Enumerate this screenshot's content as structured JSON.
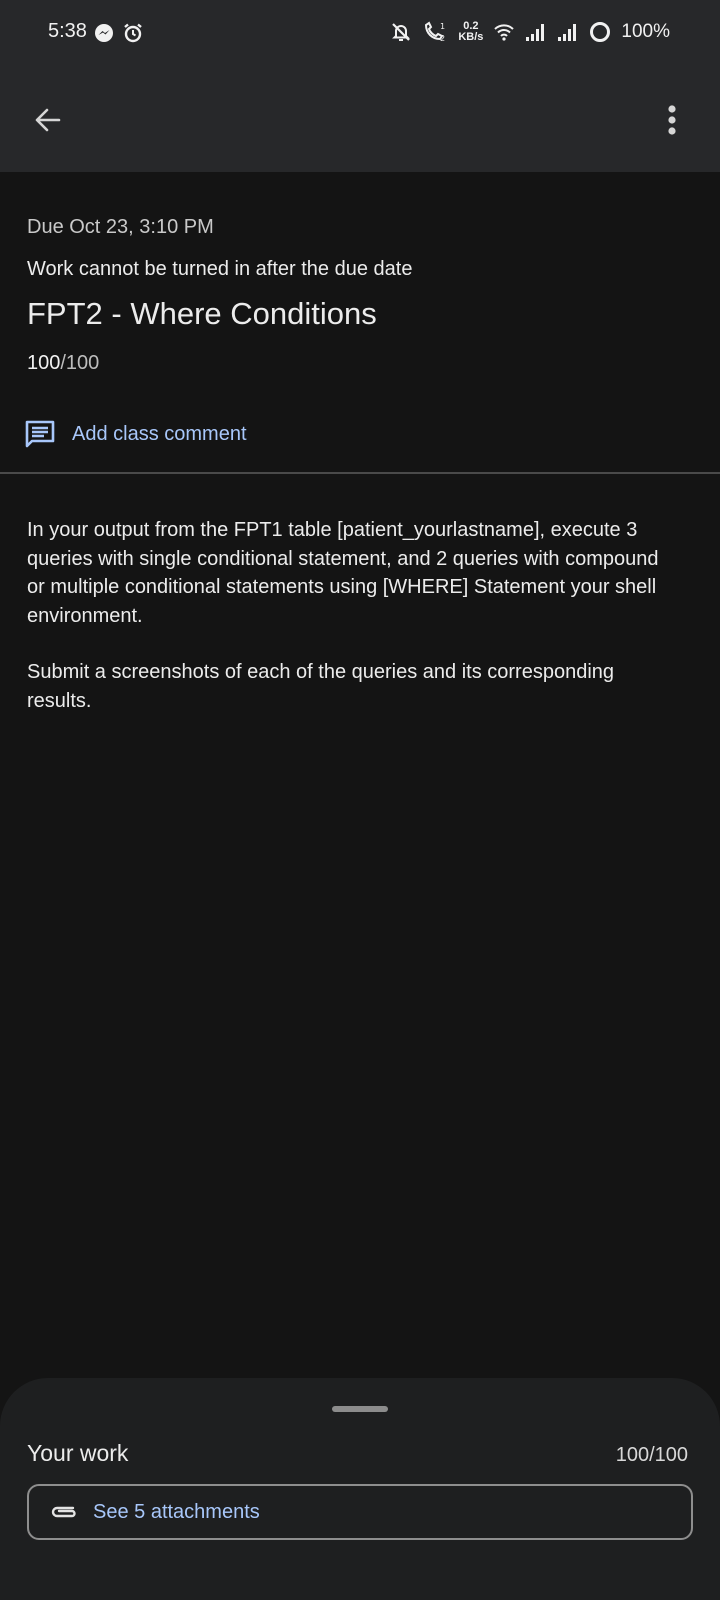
{
  "status_bar": {
    "time": "5:38",
    "data_rate_value": "0.2",
    "data_rate_unit": "KB/s",
    "battery": "100%"
  },
  "header": {
    "back_icon": "arrow-back-icon",
    "more_icon": "more-vert-icon"
  },
  "assignment": {
    "due": "Due Oct 23, 3:10 PM",
    "late_notice": "Work cannot be turned in after the due date",
    "title": "FPT2 - Where Conditions",
    "grade_earned": "100",
    "grade_total": "/100",
    "add_comment_label": "Add class comment",
    "description_p1": "In your output from the FPT1 table [patient_yourlastname], execute 3 queries with single conditional statement, and 2 queries with compound or multiple conditional statements using [WHERE] Statement your shell environment.",
    "description_p2": "Submit a screenshots of each of the queries and its corresponding results."
  },
  "your_work": {
    "label": "Your work",
    "grade": "100/100",
    "attachments_label": "See 5 attachments"
  },
  "colors": {
    "background": "#141414",
    "app_bar": "#27282a",
    "accent_link": "#a8c7fa",
    "sheet": "#1e1f20"
  }
}
